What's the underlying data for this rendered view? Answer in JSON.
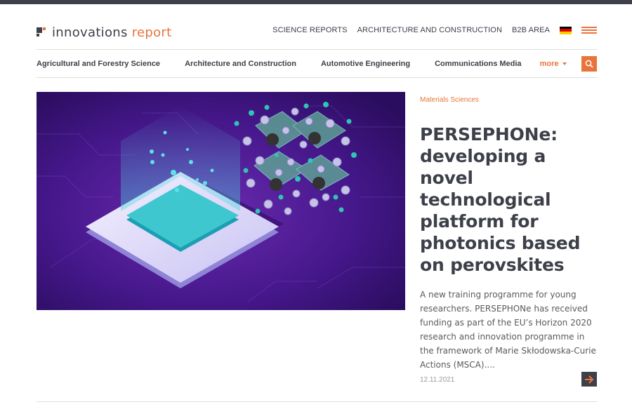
{
  "brand": {
    "name_part1": "innovations",
    "name_part2": "report",
    "accent_color": "#e8743b",
    "dark_color": "#3d4049"
  },
  "top_nav": {
    "links": [
      "SCIENCE REPORTS",
      "ARCHITECTURE AND CONSTRUCTION",
      "B2B AREA"
    ],
    "language_flag": "german-flag-icon",
    "menu_icon": "hamburger-icon"
  },
  "category_nav": {
    "items": [
      "Agricultural and Forestry Science",
      "Architecture and Construction",
      "Automotive Engineering",
      "Communications Media"
    ],
    "more_label": "more",
    "search_icon": "search-icon"
  },
  "featured_article": {
    "category": "Materials Sciences",
    "title": "PERSEPHONe: developing a novel technological platform for photonics based on perovskites",
    "teaser": "A new training programme for young researchers. PERSEPHONe has received funding as part of the EU’s Horizon 2020 research and innovation programme in the framework of Marie Skłodowska-Curie Actions (MSCA)....",
    "date": "12.11.2021",
    "read_more_icon": "arrow-right-icon"
  }
}
